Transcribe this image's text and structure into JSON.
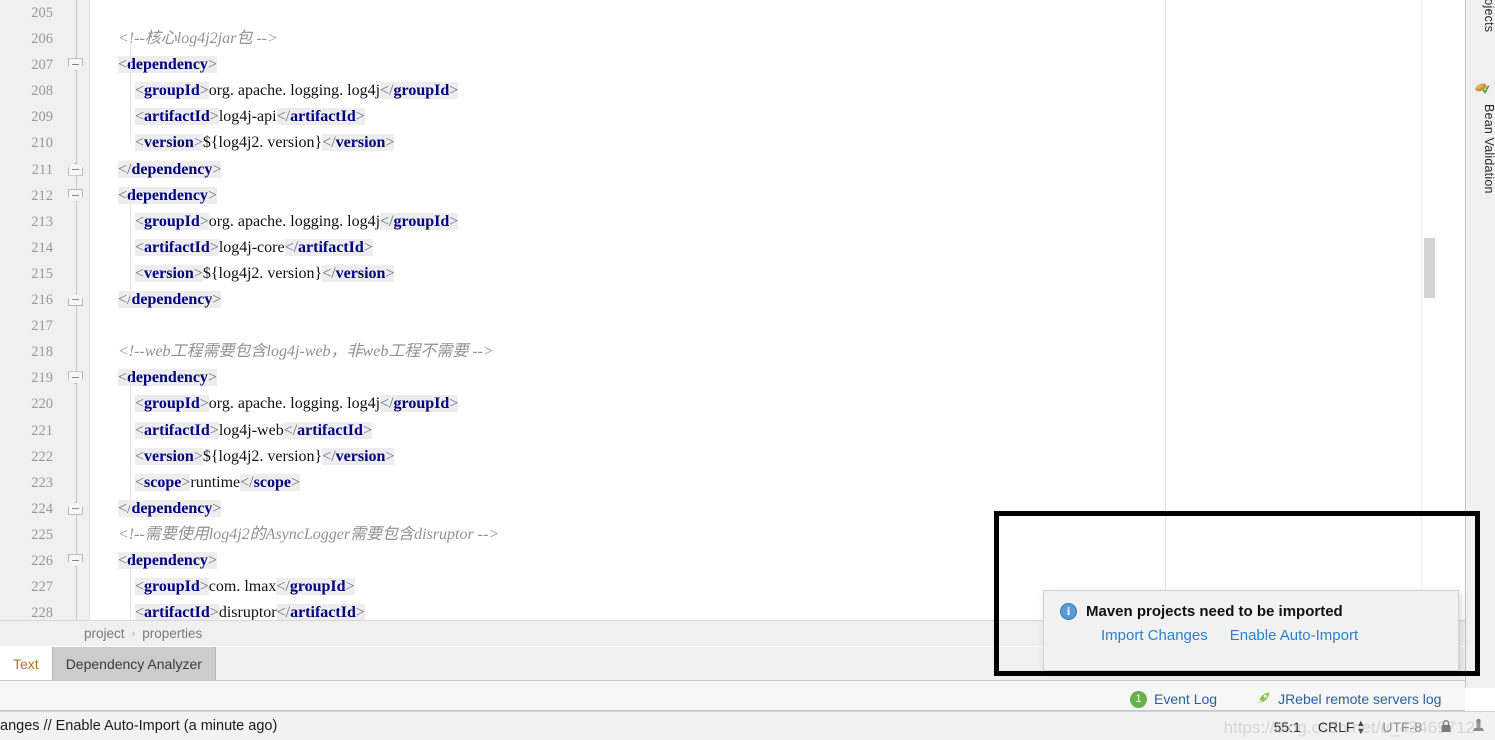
{
  "editor": {
    "first_line_number": 205,
    "lines": [
      {
        "n": 205,
        "fold": null,
        "tokens": []
      },
      {
        "n": 206,
        "fold": null,
        "indent": 0,
        "tokens": [
          {
            "t": "cmt",
            "s": "<!--核心log4j2jar包 -->"
          }
        ]
      },
      {
        "n": 207,
        "fold": "open-top",
        "indent": 0,
        "tokens": [
          {
            "t": "brh",
            "s": "<"
          },
          {
            "t": "tag",
            "s": "dependency"
          },
          {
            "t": "brh",
            "s": ">"
          }
        ]
      },
      {
        "n": 208,
        "fold": null,
        "indent": 1,
        "tokens": [
          {
            "t": "brh",
            "s": "<"
          },
          {
            "t": "tag",
            "s": "groupId"
          },
          {
            "t": "brh",
            "s": ">"
          },
          {
            "t": "txt",
            "s": "org. apache. logging. log4j"
          },
          {
            "t": "brh",
            "s": "</"
          },
          {
            "t": "tag",
            "s": "groupId"
          },
          {
            "t": "brh",
            "s": ">"
          }
        ]
      },
      {
        "n": 209,
        "fold": null,
        "indent": 1,
        "tokens": [
          {
            "t": "brh",
            "s": "<"
          },
          {
            "t": "tag",
            "s": "artifactId"
          },
          {
            "t": "brh",
            "s": ">"
          },
          {
            "t": "txt",
            "s": "log4j-api"
          },
          {
            "t": "brh",
            "s": "</"
          },
          {
            "t": "tag",
            "s": "artifactId"
          },
          {
            "t": "brh",
            "s": ">"
          }
        ]
      },
      {
        "n": 210,
        "fold": null,
        "indent": 1,
        "tokens": [
          {
            "t": "brh",
            "s": "<"
          },
          {
            "t": "tag",
            "s": "version"
          },
          {
            "t": "brh",
            "s": ">"
          },
          {
            "t": "txt",
            "s": "${log4j2. version}"
          },
          {
            "t": "brh",
            "s": "</"
          },
          {
            "t": "tag",
            "s": "version"
          },
          {
            "t": "brh",
            "s": ">"
          }
        ]
      },
      {
        "n": 211,
        "fold": "open-bot",
        "indent": 0,
        "tokens": [
          {
            "t": "brh",
            "s": "</"
          },
          {
            "t": "tag",
            "s": "dependency"
          },
          {
            "t": "brh",
            "s": ">"
          }
        ]
      },
      {
        "n": 212,
        "fold": "open-top",
        "indent": 0,
        "tokens": [
          {
            "t": "brh",
            "s": "<"
          },
          {
            "t": "tag",
            "s": "dependency"
          },
          {
            "t": "brh",
            "s": ">"
          }
        ]
      },
      {
        "n": 213,
        "fold": null,
        "indent": 1,
        "tokens": [
          {
            "t": "brh",
            "s": "<"
          },
          {
            "t": "tag",
            "s": "groupId"
          },
          {
            "t": "brh",
            "s": ">"
          },
          {
            "t": "txt",
            "s": "org. apache. logging. log4j"
          },
          {
            "t": "brh",
            "s": "</"
          },
          {
            "t": "tag",
            "s": "groupId"
          },
          {
            "t": "brh",
            "s": ">"
          }
        ]
      },
      {
        "n": 214,
        "fold": null,
        "indent": 1,
        "tokens": [
          {
            "t": "brh",
            "s": "<"
          },
          {
            "t": "tag",
            "s": "artifactId"
          },
          {
            "t": "brh",
            "s": ">"
          },
          {
            "t": "txt",
            "s": "log4j-core"
          },
          {
            "t": "brh",
            "s": "</"
          },
          {
            "t": "tag",
            "s": "artifactId"
          },
          {
            "t": "brh",
            "s": ">"
          }
        ]
      },
      {
        "n": 215,
        "fold": null,
        "indent": 1,
        "tokens": [
          {
            "t": "brh",
            "s": "<"
          },
          {
            "t": "tag",
            "s": "version"
          },
          {
            "t": "brh",
            "s": ">"
          },
          {
            "t": "txt",
            "s": "${log4j2. version}"
          },
          {
            "t": "brh",
            "s": "</"
          },
          {
            "t": "tag",
            "s": "version"
          },
          {
            "t": "brh",
            "s": ">"
          }
        ]
      },
      {
        "n": 216,
        "fold": "open-bot",
        "indent": 0,
        "tokens": [
          {
            "t": "brh",
            "s": "</"
          },
          {
            "t": "tag",
            "s": "dependency"
          },
          {
            "t": "brh",
            "s": ">"
          }
        ]
      },
      {
        "n": 217,
        "fold": null,
        "tokens": []
      },
      {
        "n": 218,
        "fold": null,
        "indent": 0,
        "tokens": [
          {
            "t": "cmt",
            "s": "<!--web工程需要包含log4j-web，非web工程不需要 -->"
          }
        ]
      },
      {
        "n": 219,
        "fold": "open-top",
        "indent": 0,
        "tokens": [
          {
            "t": "brh",
            "s": "<"
          },
          {
            "t": "tag",
            "s": "dependency"
          },
          {
            "t": "brh",
            "s": ">"
          }
        ]
      },
      {
        "n": 220,
        "fold": null,
        "indent": 1,
        "tokens": [
          {
            "t": "brh",
            "s": "<"
          },
          {
            "t": "tag",
            "s": "groupId"
          },
          {
            "t": "brh",
            "s": ">"
          },
          {
            "t": "txt",
            "s": "org. apache. logging. log4j"
          },
          {
            "t": "brh",
            "s": "</"
          },
          {
            "t": "tag",
            "s": "groupId"
          },
          {
            "t": "brh",
            "s": ">"
          }
        ]
      },
      {
        "n": 221,
        "fold": null,
        "indent": 1,
        "tokens": [
          {
            "t": "brh",
            "s": "<"
          },
          {
            "t": "tag",
            "s": "artifactId"
          },
          {
            "t": "brh",
            "s": ">"
          },
          {
            "t": "txt",
            "s": "log4j-web"
          },
          {
            "t": "brh",
            "s": "</"
          },
          {
            "t": "tag",
            "s": "artifactId"
          },
          {
            "t": "brh",
            "s": ">"
          }
        ]
      },
      {
        "n": 222,
        "fold": null,
        "indent": 1,
        "tokens": [
          {
            "t": "brh",
            "s": "<"
          },
          {
            "t": "tag",
            "s": "version"
          },
          {
            "t": "brh",
            "s": ">"
          },
          {
            "t": "txt",
            "s": "${log4j2. version}"
          },
          {
            "t": "brh",
            "s": "</"
          },
          {
            "t": "tag",
            "s": "version"
          },
          {
            "t": "brh",
            "s": ">"
          }
        ]
      },
      {
        "n": 223,
        "fold": null,
        "indent": 1,
        "tokens": [
          {
            "t": "brh",
            "s": "<"
          },
          {
            "t": "tag",
            "s": "scope"
          },
          {
            "t": "brh",
            "s": ">"
          },
          {
            "t": "txt",
            "s": "runtime"
          },
          {
            "t": "brh",
            "s": "</"
          },
          {
            "t": "tag",
            "s": "scope"
          },
          {
            "t": "brh",
            "s": ">"
          }
        ]
      },
      {
        "n": 224,
        "fold": "open-bot",
        "indent": 0,
        "tokens": [
          {
            "t": "brh",
            "s": "</"
          },
          {
            "t": "tag",
            "s": "dependency"
          },
          {
            "t": "brh",
            "s": ">"
          }
        ]
      },
      {
        "n": 225,
        "fold": null,
        "indent": 0,
        "tokens": [
          {
            "t": "cmt",
            "s": "<!--需要使用log4j2的AsyncLogger需要包含disruptor -->"
          }
        ]
      },
      {
        "n": 226,
        "fold": "open-top",
        "indent": 0,
        "tokens": [
          {
            "t": "brh",
            "s": "<"
          },
          {
            "t": "tag",
            "s": "dependency"
          },
          {
            "t": "brh",
            "s": ">"
          }
        ]
      },
      {
        "n": 227,
        "fold": null,
        "indent": 1,
        "tokens": [
          {
            "t": "brh",
            "s": "<"
          },
          {
            "t": "tag",
            "s": "groupId"
          },
          {
            "t": "brh",
            "s": ">"
          },
          {
            "t": "txt",
            "s": "com. lmax"
          },
          {
            "t": "brh",
            "s": "</"
          },
          {
            "t": "tag",
            "s": "groupId"
          },
          {
            "t": "brh",
            "s": ">"
          }
        ]
      },
      {
        "n": 228,
        "fold": null,
        "indent": 1,
        "tokens": [
          {
            "t": "brh",
            "s": "<"
          },
          {
            "t": "tag",
            "s": "artifactId"
          },
          {
            "t": "brh",
            "s": ">"
          },
          {
            "t": "txt",
            "s": "disruptor"
          },
          {
            "t": "brh",
            "s": "</"
          },
          {
            "t": "tag",
            "s": "artifactId"
          },
          {
            "t": "brh",
            "s": ">"
          }
        ]
      }
    ]
  },
  "breadcrumb": {
    "items": [
      "project",
      "properties"
    ],
    "separator": "›"
  },
  "bottom_tabs": [
    {
      "label": "Text",
      "active": true
    },
    {
      "label": "Dependency Analyzer",
      "active": false
    }
  ],
  "right_strip": {
    "tabs": [
      {
        "label": "rojects",
        "icon": null
      },
      {
        "label": "Bean Validation",
        "icon": "bean-icon"
      }
    ]
  },
  "notification": {
    "icon": "info-icon",
    "icon_glyph": "i",
    "title": "Maven projects need to be imported",
    "links": [
      "Import Changes",
      "Enable Auto-Import"
    ]
  },
  "event_row": [
    {
      "badge": "1",
      "label": "Event Log",
      "icon": "event-log-icon"
    },
    {
      "badge": null,
      "label": "JRebel remote servers log",
      "icon": "rocket-icon"
    }
  ],
  "statusbar": {
    "left_text": "anges // Enable Auto-Import (a minute ago)",
    "caret": "55:1",
    "line_separator": "CRLF",
    "encoding": "UTF-8",
    "lock_icon": "lock-icon",
    "inspection_icon": "inspection-icon"
  },
  "watermark": {
    "text": "https://blog.csdn.net/u_43469712"
  },
  "colors": {
    "tag": "#000080",
    "comment": "#919191",
    "link": "#2b7fd0",
    "active_tab_text": "#b07430",
    "highlight_border": "#000000",
    "badge_green": "#6ab04c",
    "info_blue": "#5b9bd5"
  }
}
